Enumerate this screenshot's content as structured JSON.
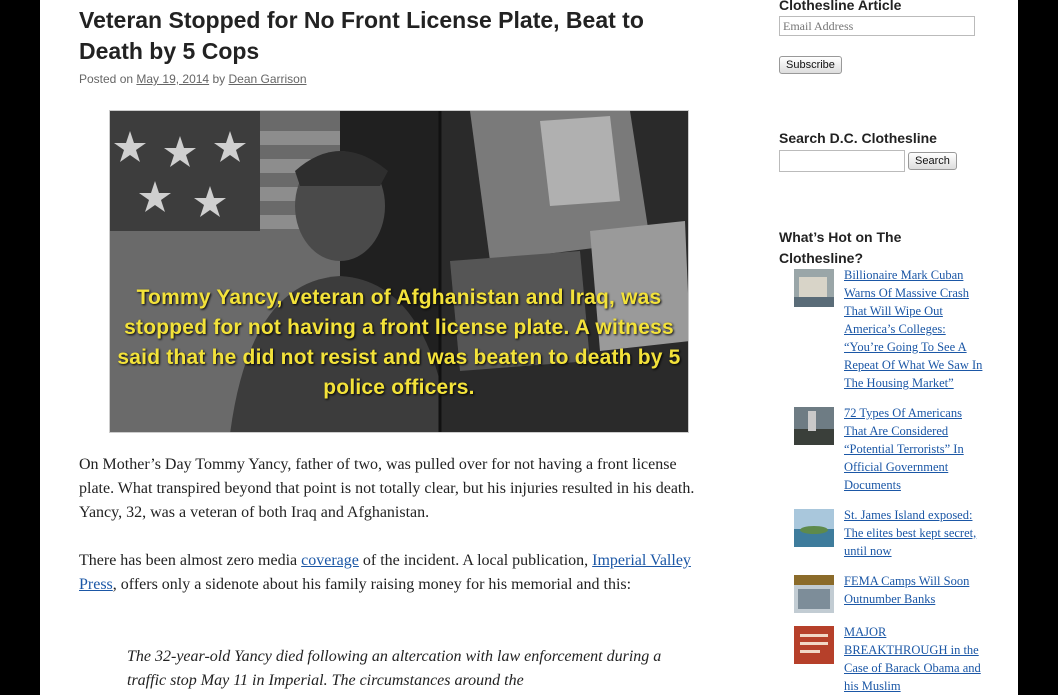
{
  "article": {
    "title": "Veteran Stopped for No Front License Plate, Beat to Death by 5 Cops",
    "posted_on_label": "Posted on",
    "date": "May 19, 2014",
    "by_label": "by",
    "author": "Dean Garrison",
    "image_caption": "Tommy Yancy, veteran of Afghanistan and Iraq, was stopped for not having a front license plate. A witness said that he did not resist and was beaten to death by 5 police officers.",
    "paragraph1": "On Mother’s Day Tommy Yancy, father of two, was pulled over for not having a front license plate. What transpired beyond that point is not totally clear, but his injuries resulted in his death. Yancy, 32, was a veteran of both Iraq and Afghanistan.",
    "paragraph2_before": "There has been almost zero media ",
    "paragraph2_link1": "coverage",
    "paragraph2_middle": " of the incident. A local publication, ",
    "paragraph2_link2": "Imperial Valley Press",
    "paragraph2_after": ", offers only a sidenote about his family raising money for his memorial and this:",
    "quote": "The 32-year-old Yancy died following an altercation with law enforcement during a traffic stop May 11 in Imperial. The circumstances around the"
  },
  "sidebar": {
    "subscribe_heading": "Clothesline Article",
    "email_placeholder": "Email Address",
    "subscribe_button": "Subscribe",
    "search_heading": "Search D.C. Clothesline",
    "search_value": "",
    "search_button": "Search",
    "hot_heading": "What’s Hot on The Clothesline?",
    "hot_items": [
      {
        "title": "Billionaire Mark Cuban Warns Of Massive Crash That Will Wipe Out America’s Colleges: “You’re Going To See A Repeat Of What We Saw In The Housing Market”",
        "thumb_icon": "news-thumbnail"
      },
      {
        "title": "72 Types Of Americans That Are Considered “Potential Terrorists” In Official Government Documents",
        "thumb_icon": "news-thumbnail"
      },
      {
        "title": "St. James Island exposed: The elites best kept secret, until now",
        "thumb_icon": "news-thumbnail"
      },
      {
        "title": "FEMA Camps Will Soon Outnumber Banks",
        "thumb_icon": "news-thumbnail"
      },
      {
        "title": "MAJOR BREAKTHROUGH in the Case of Barack Obama and his Muslim",
        "thumb_icon": "news-thumbnail"
      }
    ]
  },
  "colors": {
    "link": "#1b57a6",
    "caption": "#f3e23a",
    "background": "#000000"
  }
}
